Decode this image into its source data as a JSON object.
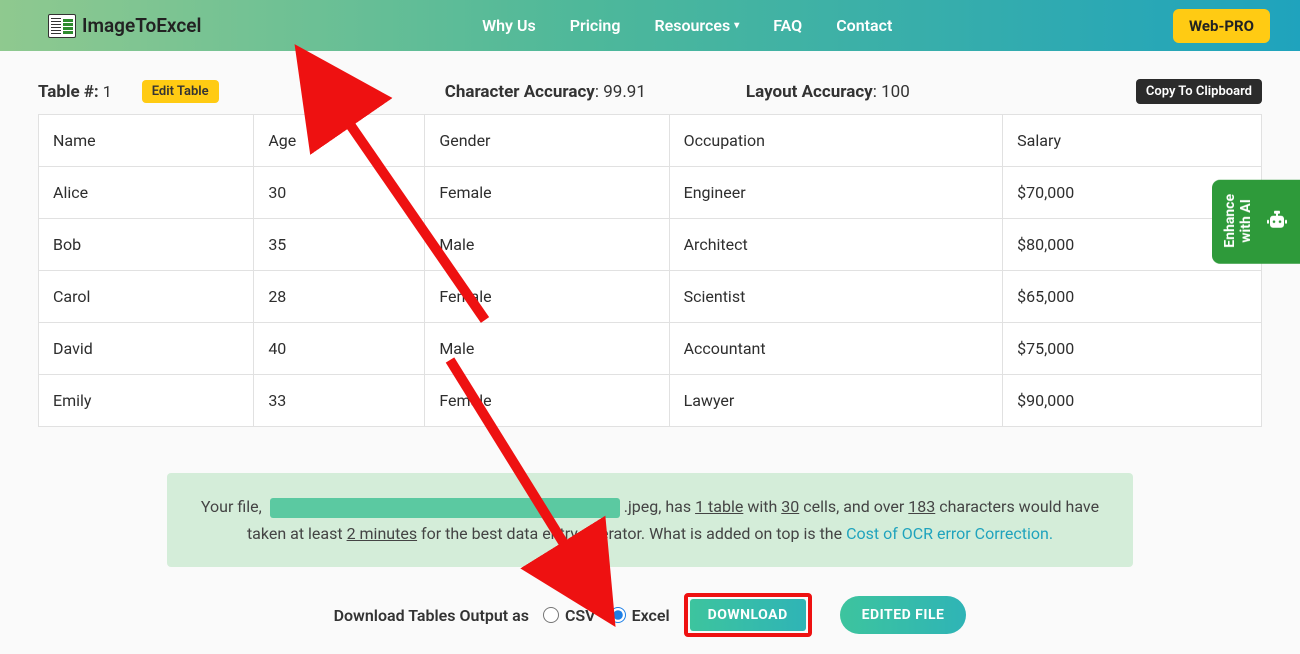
{
  "header": {
    "logo_text": "ImageToExcel",
    "nav": [
      "Why Us",
      "Pricing",
      "Resources",
      "FAQ",
      "Contact"
    ],
    "web_pro": "Web-PRO"
  },
  "meta": {
    "table_num_label": "Table #:",
    "table_num_value": "1",
    "edit_table": "Edit Table",
    "char_acc_label": "Character Accuracy",
    "char_acc_value": "99.91",
    "layout_acc_label": "Layout Accuracy",
    "layout_acc_value": "100",
    "copy_btn": "Copy To Clipboard"
  },
  "table": {
    "headers": [
      "Name",
      "Age",
      "Gender",
      "Occupation",
      "Salary"
    ],
    "rows": [
      [
        "Alice",
        "30",
        "Female",
        "Engineer",
        "$70,000"
      ],
      [
        "Bob",
        "35",
        "Male",
        "Architect",
        "$80,000"
      ],
      [
        "Carol",
        "28",
        "Female",
        "Scientist",
        "$65,000"
      ],
      [
        "David",
        "40",
        "Male",
        "Accountant",
        "$75,000"
      ],
      [
        "Emily",
        "33",
        "Female",
        "Lawyer",
        "$90,000"
      ]
    ]
  },
  "info": {
    "prefix": "Your file,",
    "ext": ".jpeg",
    "mid1": ", has ",
    "tables": "1 table",
    "mid2": " with ",
    "cells": "30",
    "mid3": " cells, and over ",
    "chars": "183",
    "mid4": " characters would have taken at least ",
    "minutes": "2 minutes",
    "mid5": " for the best data entry operator. What is added on top is the ",
    "link": "Cost of OCR error Correction.",
    "tail": ""
  },
  "download": {
    "label": "Download Tables Output as",
    "csv": "CSV",
    "excel": "Excel",
    "download_btn": "DOWNLOAD",
    "edited_btn": "EDITED FILE"
  },
  "sidebar": {
    "enhance": "Enhance\nwith AI"
  }
}
